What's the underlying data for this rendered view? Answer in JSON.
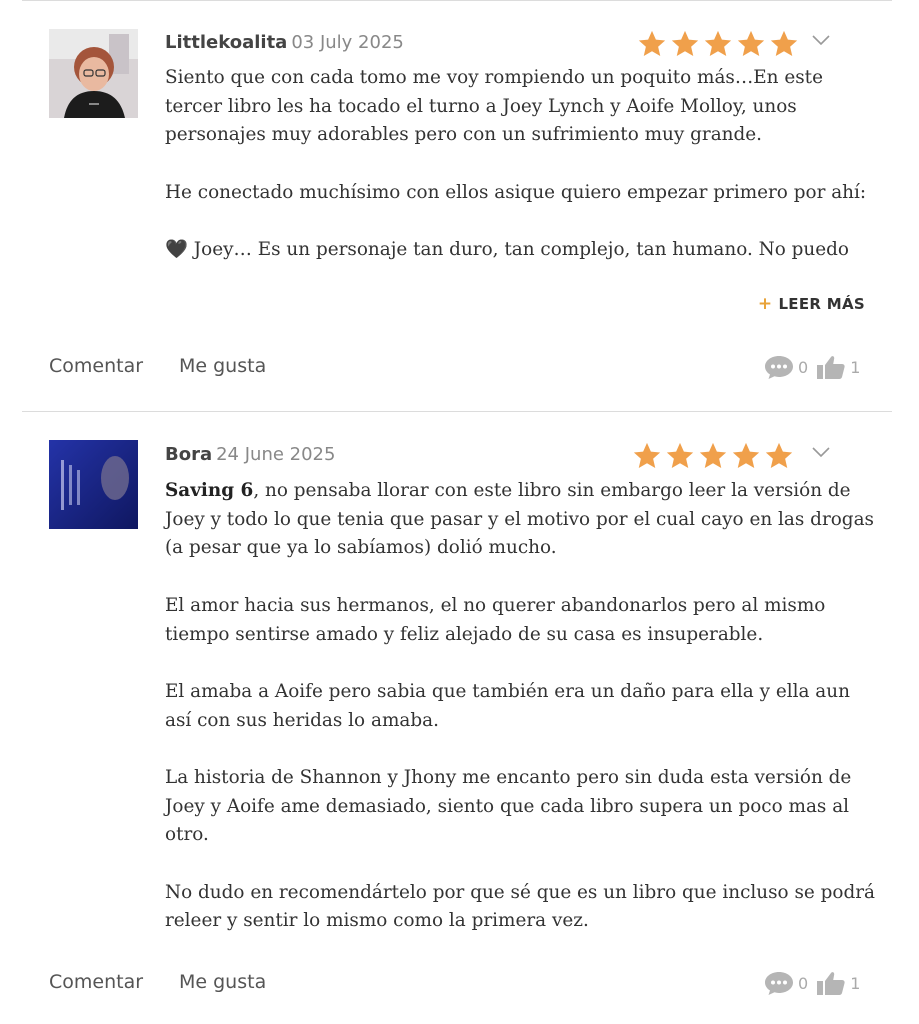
{
  "reviews": [
    {
      "user": "Littlekoalita",
      "date": "03 July 2025",
      "rating": 5,
      "paragraphs": [
        "Siento que con cada tomo me voy rompiendo un poquito más…En este tercer libro les ha tocado el turno a Joey Lynch y Aoife Molloy, unos personajes muy adorables pero con un sufrimiento muy grande.",
        "He conectado muchísimo con ellos asique quiero empezar primero por ahí:",
        "🖤 Joey… Es un personaje tan duro, tan complejo, tan humano. No puedo"
      ],
      "read_more": "LEER MÁS",
      "comment_label": "Comentar",
      "like_label": "Me gusta",
      "comment_count": "0",
      "like_count": "1"
    },
    {
      "user": "Bora",
      "date": "24 June 2025",
      "rating": 5,
      "bold_lead": "Saving 6",
      "first_rest": ", no pensaba llorar con este libro sin embargo leer la versión de Joey y todo lo que tenia que pasar y el motivo por el cual cayo en las drogas (a pesar que ya lo sabíamos) dolió mucho.",
      "paragraphs": [
        "El amor hacia sus hermanos, el no querer abandonarlos pero al mismo tiempo sentirse amado y feliz alejado de su casa es insuperable.",
        "El amaba a Aoife pero sabia que también era un daño para ella y ella aun así con sus heridas lo amaba.",
        "La historia de Shannon y Jhony me encanto pero sin duda esta versión de Joey y Aoife ame demasiado, siento que cada libro supera un poco mas al otro.",
        "No dudo en recomendártelo por que sé que es un libro que incluso se podrá releer y sentir lo mismo como la primera vez."
      ],
      "comment_label": "Comentar",
      "like_label": "Me gusta",
      "comment_count": "0",
      "like_count": "1"
    }
  ],
  "colors": {
    "star": "#f0a04b",
    "accent": "#e8a33a",
    "divider": "#dcdcdc"
  }
}
